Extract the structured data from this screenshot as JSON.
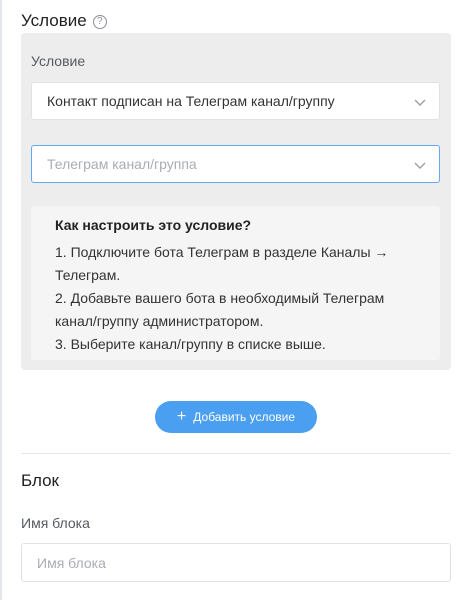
{
  "condition_section": {
    "title": "Условие",
    "help_icon": "question-circle-icon",
    "panel": {
      "label": "Условие",
      "condition_select": {
        "value": "Контакт подписан на Телеграм канал/группу",
        "icon": "chevron-down-icon"
      },
      "channel_select": {
        "placeholder": "Телеграм канал/группа",
        "icon": "chevron-down-icon",
        "focus_color": "#62a8f2"
      },
      "help": {
        "title": "Как настроить это условие?",
        "steps": [
          "1. Подключите бота Телеграм в разделе Каналы → Телеграм.",
          "2. Добавьте вашего бота в необходимый Телеграм канал/группу администратором.",
          "3. Выберите канал/группу в списке выше."
        ]
      }
    },
    "add_button": {
      "label": "Добавить условие",
      "icon": "plus-icon",
      "color": "#4a9ff0"
    }
  },
  "block_section": {
    "title": "Блок",
    "name_label": "Имя блока",
    "name_placeholder": "Имя блока",
    "name_value": ""
  }
}
